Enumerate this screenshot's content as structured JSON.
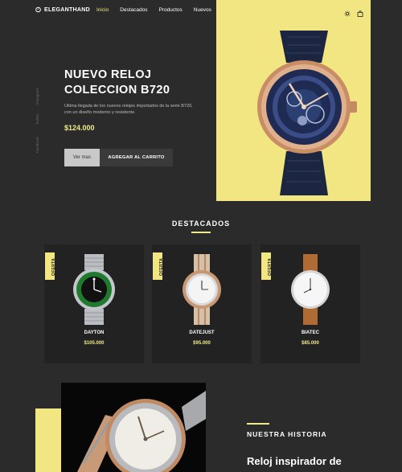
{
  "header": {
    "brand": "ELEGANTHAND",
    "nav": [
      "Inicio",
      "Destacados",
      "Productos",
      "Nuevos"
    ],
    "active_nav": "Inicio",
    "icons": [
      "theme-toggle-icon",
      "shopping-bag-icon"
    ]
  },
  "social": [
    "Instagram",
    "Twitter",
    "Facebook"
  ],
  "hero": {
    "title_line1": "NUEVO RELOJ",
    "title_line2": "COLECCION B720",
    "description": "Ultima llegada de los nuevos relojes importados de la serie B720, con un diseño moderno y resistente.",
    "price": "$124.000",
    "btn_more": "Ver mas",
    "btn_cart": "AGREGAR AL CARRITO"
  },
  "featured": {
    "title": "DESTACADOS",
    "badge": "OFERTA",
    "products": [
      {
        "name": "DAYTON",
        "price": "$105.000"
      },
      {
        "name": "DATEJUST",
        "price": "$95.000"
      },
      {
        "name": "BIATEC",
        "price": "$85.000"
      }
    ]
  },
  "story": {
    "label": "NUESTRA HISTORIA",
    "title": "Reloj inspirador de"
  },
  "colors": {
    "accent": "#f2e683",
    "accent_text": "#eee98a",
    "background": "#2b2b2b",
    "card": "#222222"
  }
}
